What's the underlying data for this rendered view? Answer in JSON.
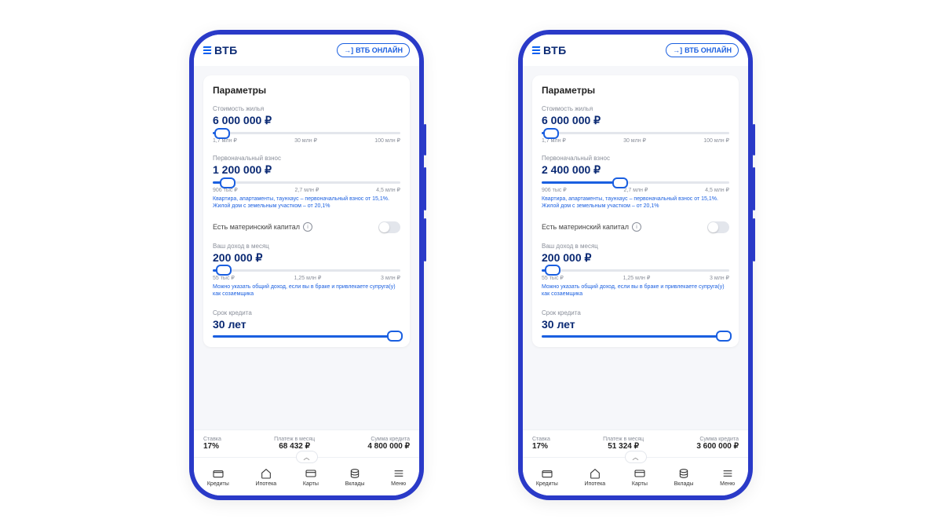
{
  "header": {
    "brand": "ВТБ",
    "online_label": "ВТБ ОНЛАЙН"
  },
  "card_title": "Параметры",
  "sliders": {
    "price": {
      "label": "Стоимость жилья",
      "value": "6 000 000 ₽",
      "scale": [
        "1,7 млн ₽",
        "30 млн ₽",
        "100 млн ₽"
      ]
    },
    "down_left": {
      "label": "Первоначальный взнос",
      "value": "1 200 000 ₽",
      "scale": [
        "906 тыс ₽",
        "2,7 млн ₽",
        "4,5 млн ₽"
      ],
      "hint": "Квартира, апартаменты, таунхаус – первоначальный взнос от 15,1%. Жилой дом с земельным участком – от 20,1%",
      "pct": 8
    },
    "down_right": {
      "label": "Первоначальный взнос",
      "value": "2 400 000 ₽",
      "scale": [
        "906 тыс ₽",
        "2,7 млн ₽",
        "4,5 млн ₽"
      ],
      "hint": "Квартира, апартаменты, таунхаус – первоначальный взнос от 15,1%. Жилой дом с земельным участком – от 20,1%",
      "pct": 42
    },
    "income": {
      "label": "Ваш доход в месяц",
      "value": "200 000 ₽",
      "scale": [
        "55 тыс ₽",
        "1,25 млн ₽",
        "3 млн ₽"
      ],
      "hint": "Можно указать общий доход, если вы в браке и привлекаете супруга(у) как созаемщика",
      "pct": 6
    },
    "term": {
      "label": "Срок кредита",
      "value": "30 лет",
      "pct": 100
    }
  },
  "toggle": {
    "label": "Есть материнский капитал"
  },
  "summary_labels": {
    "rate": "Ставка",
    "monthly": "Платеж в месяц",
    "amount": "Сумма кредита"
  },
  "summary_left": {
    "rate": "17%",
    "monthly": "68 432 ₽",
    "amount": "4 800 000 ₽"
  },
  "summary_right": {
    "rate": "17%",
    "monthly": "51 324 ₽",
    "amount": "3 600 000 ₽"
  },
  "nav": {
    "0": "Кредиты",
    "1": "Ипотека",
    "2": "Карты",
    "3": "Вклады",
    "4": "Меню"
  }
}
